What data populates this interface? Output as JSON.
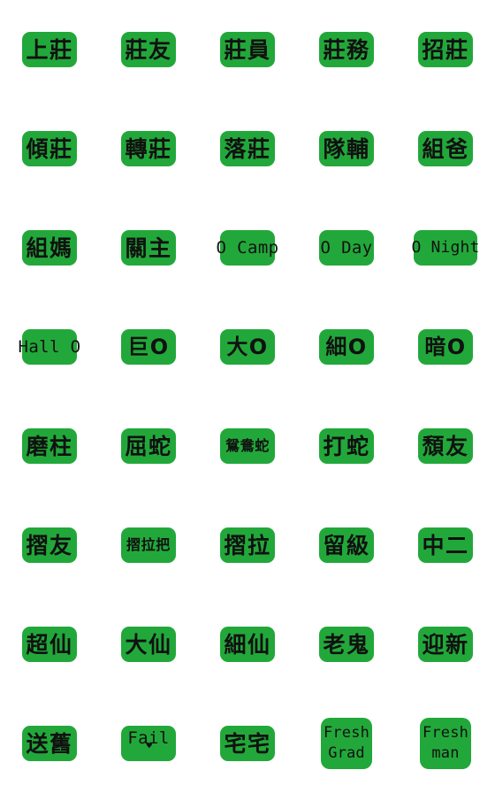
{
  "sheet": {
    "title": "Sticker Sheet",
    "tile_color": "#22a83a",
    "text_color": "#111111",
    "background_color": "#ffffff",
    "columns": 5,
    "rows": 8
  },
  "stickers": [
    [
      {
        "text": "上莊",
        "style": "cjk2"
      },
      {
        "text": "莊友",
        "style": "cjk2"
      },
      {
        "text": "莊員",
        "style": "cjk2"
      },
      {
        "text": "莊務",
        "style": "cjk2"
      },
      {
        "text": "招莊",
        "style": "cjk2"
      }
    ],
    [
      {
        "text": "傾莊",
        "style": "cjk2"
      },
      {
        "text": "轉莊",
        "style": "cjk2"
      },
      {
        "text": "落莊",
        "style": "cjk2"
      },
      {
        "text": "隊輔",
        "style": "cjk2"
      },
      {
        "text": "組爸",
        "style": "cjk2"
      }
    ],
    [
      {
        "text": "組媽",
        "style": "cjk2"
      },
      {
        "text": "關主",
        "style": "cjk2"
      },
      {
        "text": "O Camp",
        "style": "latin"
      },
      {
        "text": "O Day",
        "style": "latin"
      },
      {
        "text": "O Night",
        "style": "latin-wide"
      }
    ],
    [
      {
        "text": "Hall O",
        "style": "latin"
      },
      {
        "text": "巨O",
        "style": "mixed"
      },
      {
        "text": "大O",
        "style": "mixed"
      },
      {
        "text": "細O",
        "style": "mixed"
      },
      {
        "text": "暗O",
        "style": "mixed"
      }
    ],
    [
      {
        "text": "磨柱",
        "style": "cjk2"
      },
      {
        "text": "屈蛇",
        "style": "cjk2"
      },
      {
        "text": "鴛鴦蛇",
        "style": "cjk3"
      },
      {
        "text": "打蛇",
        "style": "cjk2"
      },
      {
        "text": "頹友",
        "style": "cjk2"
      }
    ],
    [
      {
        "text": "摺友",
        "style": "cjk2"
      },
      {
        "text": "摺拉把",
        "style": "cjk3"
      },
      {
        "text": "摺拉",
        "style": "cjk2"
      },
      {
        "text": "留級",
        "style": "cjk2"
      },
      {
        "text": "中二",
        "style": "cjk2"
      }
    ],
    [
      {
        "text": "超仙",
        "style": "cjk2"
      },
      {
        "text": "大仙",
        "style": "cjk2"
      },
      {
        "text": "細仙",
        "style": "cjk2"
      },
      {
        "text": "老鬼",
        "style": "cjk2"
      },
      {
        "text": "迎新",
        "style": "cjk2"
      }
    ],
    [
      {
        "text": "送舊",
        "style": "cjk2"
      },
      {
        "text": "Fail",
        "style": "latin",
        "decoration": "heart-over-i"
      },
      {
        "text": "宅宅",
        "style": "cjk2"
      },
      {
        "lines": [
          "Fresh",
          "Grad"
        ],
        "style": "square"
      },
      {
        "lines": [
          "Fresh",
          "man"
        ],
        "style": "square"
      }
    ]
  ]
}
